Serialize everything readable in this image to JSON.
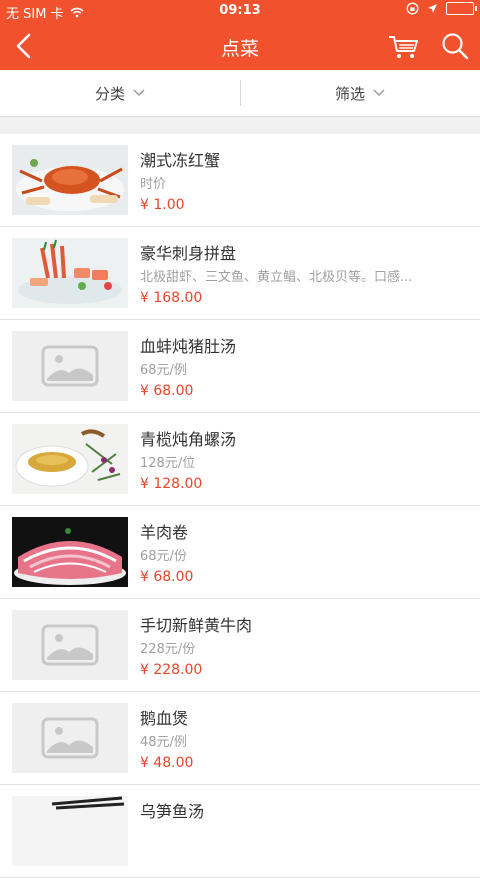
{
  "status": {
    "carrier": "无 SIM 卡",
    "time": "09:13"
  },
  "nav": {
    "title": "点菜"
  },
  "filters": {
    "category": "分类",
    "filter": "筛选"
  },
  "menu_items": [
    {
      "name": "潮式冻红蟹",
      "desc": "时价",
      "price": "¥ 1.00",
      "image": "crab"
    },
    {
      "name": "豪华刺身拼盘",
      "desc": "北极甜虾、三文鱼、黄立鲳、北极贝等。口感...",
      "price": "¥ 168.00",
      "image": "sashimi"
    },
    {
      "name": "血蚌炖猪肚汤",
      "desc": "68元/例",
      "price": "¥ 68.00",
      "image": "placeholder"
    },
    {
      "name": "青榄炖角螺汤",
      "desc": "128元/位",
      "price": "¥ 128.00",
      "image": "soup"
    },
    {
      "name": "羊肉卷",
      "desc": "68元/份",
      "price": "¥ 68.00",
      "image": "lamb"
    },
    {
      "name": "手切新鲜黄牛肉",
      "desc": "228元/份",
      "price": "¥ 228.00",
      "image": "placeholder"
    },
    {
      "name": "鹅血煲",
      "desc": "48元/例",
      "price": "¥ 48.00",
      "image": "placeholder"
    },
    {
      "name": "乌笋鱼汤",
      "desc": "",
      "price": "",
      "image": "chopsticks"
    }
  ],
  "colors": {
    "accent": "#f1512d",
    "price": "#e8452a"
  }
}
